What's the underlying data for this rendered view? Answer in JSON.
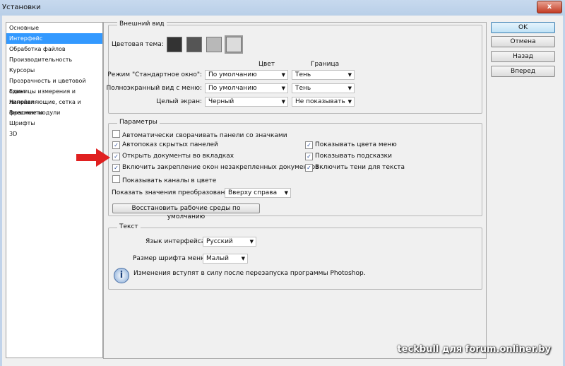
{
  "window": {
    "title": "Установки",
    "close": "x"
  },
  "sidebar": {
    "items": [
      {
        "label": "Основные"
      },
      {
        "label": "Интерфейс",
        "selected": true
      },
      {
        "label": "Обработка файлов"
      },
      {
        "label": "Производительность"
      },
      {
        "label": "Курсоры"
      },
      {
        "label": "Прозрачность и цветовой охват"
      },
      {
        "label": "Единицы измерения и линейки"
      },
      {
        "label": "Направляющие, сетка и фрагменты"
      },
      {
        "label": "Внешние модули"
      },
      {
        "label": "Шрифты"
      },
      {
        "label": "3D"
      }
    ]
  },
  "appearance": {
    "title": "Внешний вид",
    "theme_label": "Цветовая тема:",
    "theme_colors": [
      "#333333",
      "#555555",
      "#b8b8b8",
      "#dcdcdc"
    ],
    "col_color": "Цвет",
    "col_border": "Граница",
    "rows": [
      {
        "label": "Режим \"Стандартное окно\":",
        "color": "По умолчанию",
        "border": "Тень"
      },
      {
        "label": "Полноэкранный вид с меню:",
        "color": "По умолчанию",
        "border": "Тень"
      },
      {
        "label": "Целый экран:",
        "color": "Черный",
        "border": "Не показывать"
      }
    ]
  },
  "params": {
    "title": "Параметры",
    "left": [
      {
        "label": "Автоматически сворачивать панели со значками",
        "checked": false
      },
      {
        "label": "Автопоказ скрытых панелей",
        "checked": true
      },
      {
        "label": "Открыть документы во вкладках",
        "checked": true
      },
      {
        "label": "Включить закрепление окон незакрепленных документов",
        "checked": true
      },
      {
        "label": "Показывать каналы в цвете",
        "checked": false
      }
    ],
    "right": [
      {
        "label": "Показывать цвета меню",
        "checked": true
      },
      {
        "label": "Показывать подсказки",
        "checked": true
      },
      {
        "label": "Включить тени для текста",
        "checked": true
      }
    ],
    "transform_label": "Показать значения преобразования:",
    "transform_value": "Вверху справа",
    "restore_button": "Восстановить рабочие среды по умолчанию"
  },
  "text": {
    "title": "Текст",
    "lang_label": "Язык интерфейса:",
    "lang_value": "Русский",
    "size_label": "Размер шрифта меню:",
    "size_value": "Малый",
    "info": "Изменения вступят в силу после перезапуска программы Photoshop."
  },
  "buttons": {
    "ok": "OK",
    "cancel": "Отмена",
    "back": "Назад",
    "next": "Вперед"
  },
  "watermark": "teckbull для forum.onliner.by",
  "colors": {
    "selection": "#3399ff",
    "arrow": "#e02020"
  }
}
